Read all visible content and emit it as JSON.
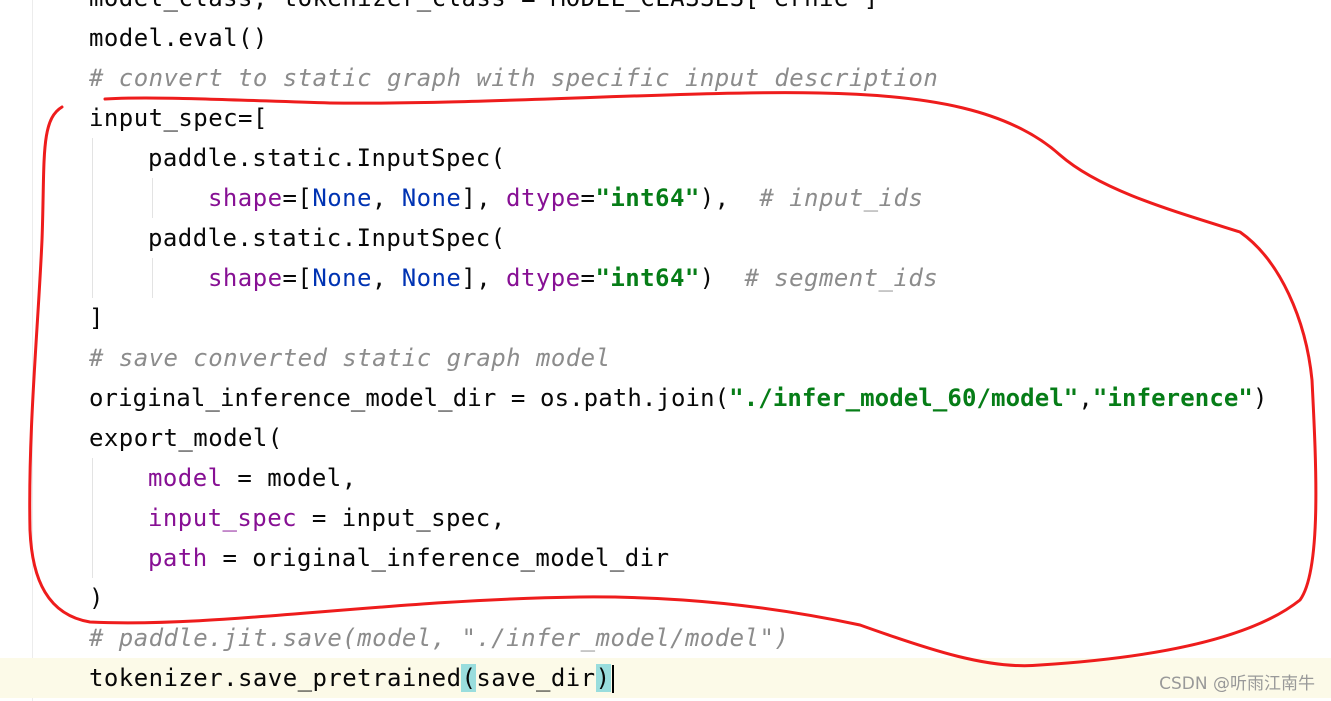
{
  "editor": {
    "lines": {
      "l0": "model_class, tokenizer_class = MODEL_CLASSES[\"ernie\"]",
      "l1": "model.eval()",
      "l2": "# convert to static graph with specific input description",
      "l3": "input_spec=[",
      "l4": "paddle.static.InputSpec(",
      "l5a": "shape",
      "l5b": "=[",
      "l5c": "None",
      "l5d": ", ",
      "l5e": "None",
      "l5f": "], ",
      "l5g": "dtype",
      "l5h": "=",
      "l5i": "\"int64\"",
      "l5j": "),  ",
      "l5k": "# input_ids",
      "l6": "paddle.static.InputSpec(",
      "l7a": "shape",
      "l7b": "=[",
      "l7c": "None",
      "l7d": ", ",
      "l7e": "None",
      "l7f": "], ",
      "l7g": "dtype",
      "l7h": "=",
      "l7i": "\"int64\"",
      "l7j": ")  ",
      "l7k": "# segment_ids",
      "l8": "]",
      "l9": "# save converted static graph model",
      "l10a": "original_inference_model_dir = os.path.join(",
      "l10b": "\"./infer_model_60/model\"",
      "l10c": ",",
      "l10d": "\"inference\"",
      "l10e": ")",
      "l11": "export_model(",
      "l12a": "model",
      "l12b": " = model,",
      "l13a": "input_spec",
      "l13b": " = input_spec,",
      "l14a": "path",
      "l14b": " = original_inference_model_dir",
      "l15": ")",
      "l16": "# paddle.jit.save(model, \"./infer_model/model\")",
      "l17a": "tokenizer.save_pretrained",
      "l17b": "(",
      "l17c": "save_dir",
      "l17d": ")"
    }
  },
  "watermark": "CSDN @听雨江南牛",
  "colors": {
    "annotation": "#ee1c1c",
    "keyword_param": "#871094",
    "none_literal": "#0033b3",
    "string": "#067d17",
    "comment": "#8c8c8c",
    "current_line_bg": "#fcfae8",
    "brace_highlight": "#99dddd"
  }
}
